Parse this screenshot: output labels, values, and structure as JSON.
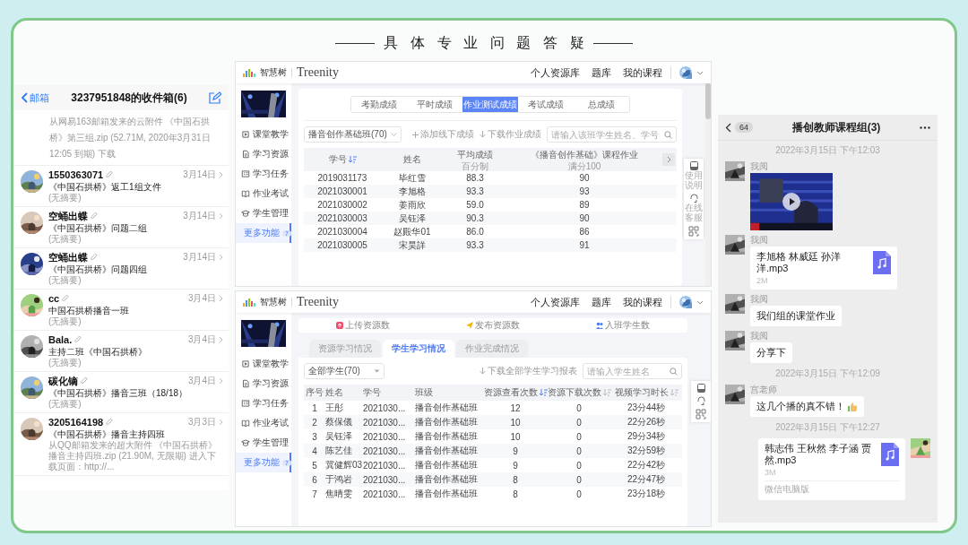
{
  "title": "具体专业问题答疑",
  "mail": {
    "back": "邮箱",
    "title": "3237951848的收件箱(6)",
    "partial_preview": "从网易163邮箱发来的云附件 《中国石拱桥》第三组.zip (52.71M, 2020年3月31日 12:05 到期) 下载",
    "items": [
      {
        "sender": "1550363071",
        "date": "3月14日",
        "subject": "《中国石拱桥》返工1组文件",
        "preview": "(无摘要)"
      },
      {
        "sender": "空蛹出蝶",
        "date": "3月14日",
        "subject": "《中国石拱桥》问题二组",
        "preview": "(无摘要)"
      },
      {
        "sender": "空蛹出蝶",
        "date": "3月14日",
        "subject": "《中国石拱桥》问题四组",
        "preview": "(无摘要)"
      },
      {
        "sender": "cc",
        "date": "3月4日",
        "subject": "中国石拱桥播音一班",
        "preview": "(无摘要)"
      },
      {
        "sender": "Bala.",
        "date": "3月4日",
        "subject": "主持二班《中国石拱桥》",
        "preview": "(无摘要)"
      },
      {
        "sender": "碳化镝",
        "date": "3月4日",
        "subject": "《中国石拱桥》播音三班（18/18）",
        "preview": "(无摘要)"
      },
      {
        "sender": "3205164198",
        "date": "3月3日",
        "subject": "《中国石拱桥》播音主持四班",
        "preview": "从QQ邮箱发来的超大附件 《中国石拱桥》播音主持四班.zip (21.90M, 无限期) 进入下载页面：http://..."
      }
    ]
  },
  "grades_screen": {
    "header": {
      "brand": "智慧树",
      "logo": "Treenity",
      "nav": [
        "个人资源库",
        "题库",
        "我的课程"
      ]
    },
    "sidebar": [
      {
        "label": "课堂教学",
        "selected": false
      },
      {
        "label": "学习资源",
        "selected": false
      },
      {
        "label": "学习任务",
        "selected": false
      },
      {
        "label": "作业考试",
        "selected": false
      },
      {
        "label": "学生管理",
        "selected": false
      },
      {
        "label": "更多功能",
        "badge": "7",
        "selected": true
      }
    ],
    "tabs": [
      {
        "label": "考勤成绩",
        "selected": false
      },
      {
        "label": "平时成绩",
        "selected": false
      },
      {
        "label": "作业测试成绩",
        "selected": true
      },
      {
        "label": "考试成绩",
        "selected": false
      },
      {
        "label": "总成绩",
        "selected": false
      }
    ],
    "class_select": "播音创作基础班(70)",
    "actions": [
      "添加线下成绩",
      "下载作业成绩"
    ],
    "search": {
      "placeholder": "请输入该班学生姓名、学号"
    },
    "columns": [
      {
        "label": "学号",
        "sorted": true
      },
      {
        "label": "姓名"
      },
      {
        "label": "平均成绩",
        "sub": "百分制"
      },
      {
        "label": "《播音创作基础》课程作业",
        "sub": "满分100"
      }
    ],
    "rows": [
      [
        "2019031173",
        "毕红雪",
        "88.3",
        "90"
      ],
      [
        "2021030001",
        "李旭格",
        "93.3",
        "93"
      ],
      [
        "2021030002",
        "姜雨欣",
        "59.0",
        "89"
      ],
      [
        "2021030003",
        "吴钰泽",
        "90.3",
        "90"
      ],
      [
        "2021030004",
        "赵殿华01",
        "86.0",
        "86"
      ],
      [
        "2021030005",
        "宋昊詳",
        "93.3",
        "91"
      ]
    ],
    "help": [
      "使用说明",
      "在线客服"
    ]
  },
  "study_screen": {
    "header": {
      "brand": "智慧树",
      "logo": "Treenity",
      "nav": [
        "个人资源库",
        "题库",
        "我的课程"
      ]
    },
    "sidebar": [
      {
        "label": "课堂教学",
        "selected": false
      },
      {
        "label": "学习资源",
        "selected": false
      },
      {
        "label": "学习任务",
        "selected": false
      },
      {
        "label": "作业考试",
        "selected": false
      },
      {
        "label": "学生管理",
        "selected": false
      },
      {
        "label": "更多功能",
        "badge": "7",
        "selected": true
      }
    ],
    "stats": [
      "上传资源数",
      "发布资源数",
      "入班学生数"
    ],
    "tabs": [
      {
        "label": "资源学习情况",
        "selected": false
      },
      {
        "label": "学生学习情况",
        "selected": true
      },
      {
        "label": "作业完成情况",
        "selected": false
      }
    ],
    "group_select": "全部学生(70)",
    "actions": [
      "下载全部学生学习报表"
    ],
    "search": {
      "placeholder": "请输入学生姓名"
    },
    "columns": [
      {
        "label": "序号"
      },
      {
        "label": "姓名"
      },
      {
        "label": "学号"
      },
      {
        "label": "班级"
      },
      {
        "label": "资源查看次数",
        "sorted": true
      },
      {
        "label": "资源下载次数",
        "sorted": false
      },
      {
        "label": "视频学习时长",
        "sorted": false
      }
    ],
    "rows": [
      [
        "1",
        "王彤",
        "2021030...",
        "播音创作基础班",
        "12",
        "0",
        "23分44秒"
      ],
      [
        "2",
        "蔡保儀",
        "2021030...",
        "播音创作基础班",
        "10",
        "0",
        "22分26秒"
      ],
      [
        "3",
        "吴钰泽",
        "2021030...",
        "播音创作基础班",
        "10",
        "0",
        "29分34秒"
      ],
      [
        "4",
        "陈艺佳",
        "2021030...",
        "播音创作基础班",
        "9",
        "0",
        "32分59秒"
      ],
      [
        "5",
        "冀健辉03",
        "2021030...",
        "播音创作基础班",
        "9",
        "0",
        "22分42秒"
      ],
      [
        "6",
        "于鸿岩",
        "2021030...",
        "播音创作基础班",
        "8",
        "0",
        "22分47秒"
      ],
      [
        "7",
        "焦晴雯",
        "2021030...",
        "播音创作基础班",
        "8",
        "0",
        "23分18秒"
      ]
    ]
  },
  "chat": {
    "badge": "64",
    "title": "播创教师课程组(3)",
    "messages": [
      {
        "kind": "time",
        "text": "2022年3月15日 下午12:03"
      },
      {
        "kind": "video",
        "sender": "我阅",
        "outgoing": false
      },
      {
        "kind": "file",
        "sender": "我阅",
        "name": "李旭格 林威廷 孙洋洋.mp3",
        "size": "2M",
        "outgoing": false
      },
      {
        "kind": "text",
        "sender": "我阅",
        "text": "我们组的课堂作业",
        "outgoing": false
      },
      {
        "kind": "text",
        "sender": "我阅",
        "text": "分享下",
        "outgoing": false
      },
      {
        "kind": "time",
        "text": "2022年3月15日 下午12:09"
      },
      {
        "kind": "text",
        "sender": "宫老师",
        "text": "这几个播的真不错！",
        "thumbs": true,
        "outgoing": false
      },
      {
        "kind": "time",
        "text": "2022年3月15日 下午12:27"
      },
      {
        "kind": "file",
        "name": "韩志伟 王秋然 李子涵 贾然.mp3",
        "size": "3M",
        "footer": "微信电脑版",
        "outgoing": true
      }
    ]
  }
}
